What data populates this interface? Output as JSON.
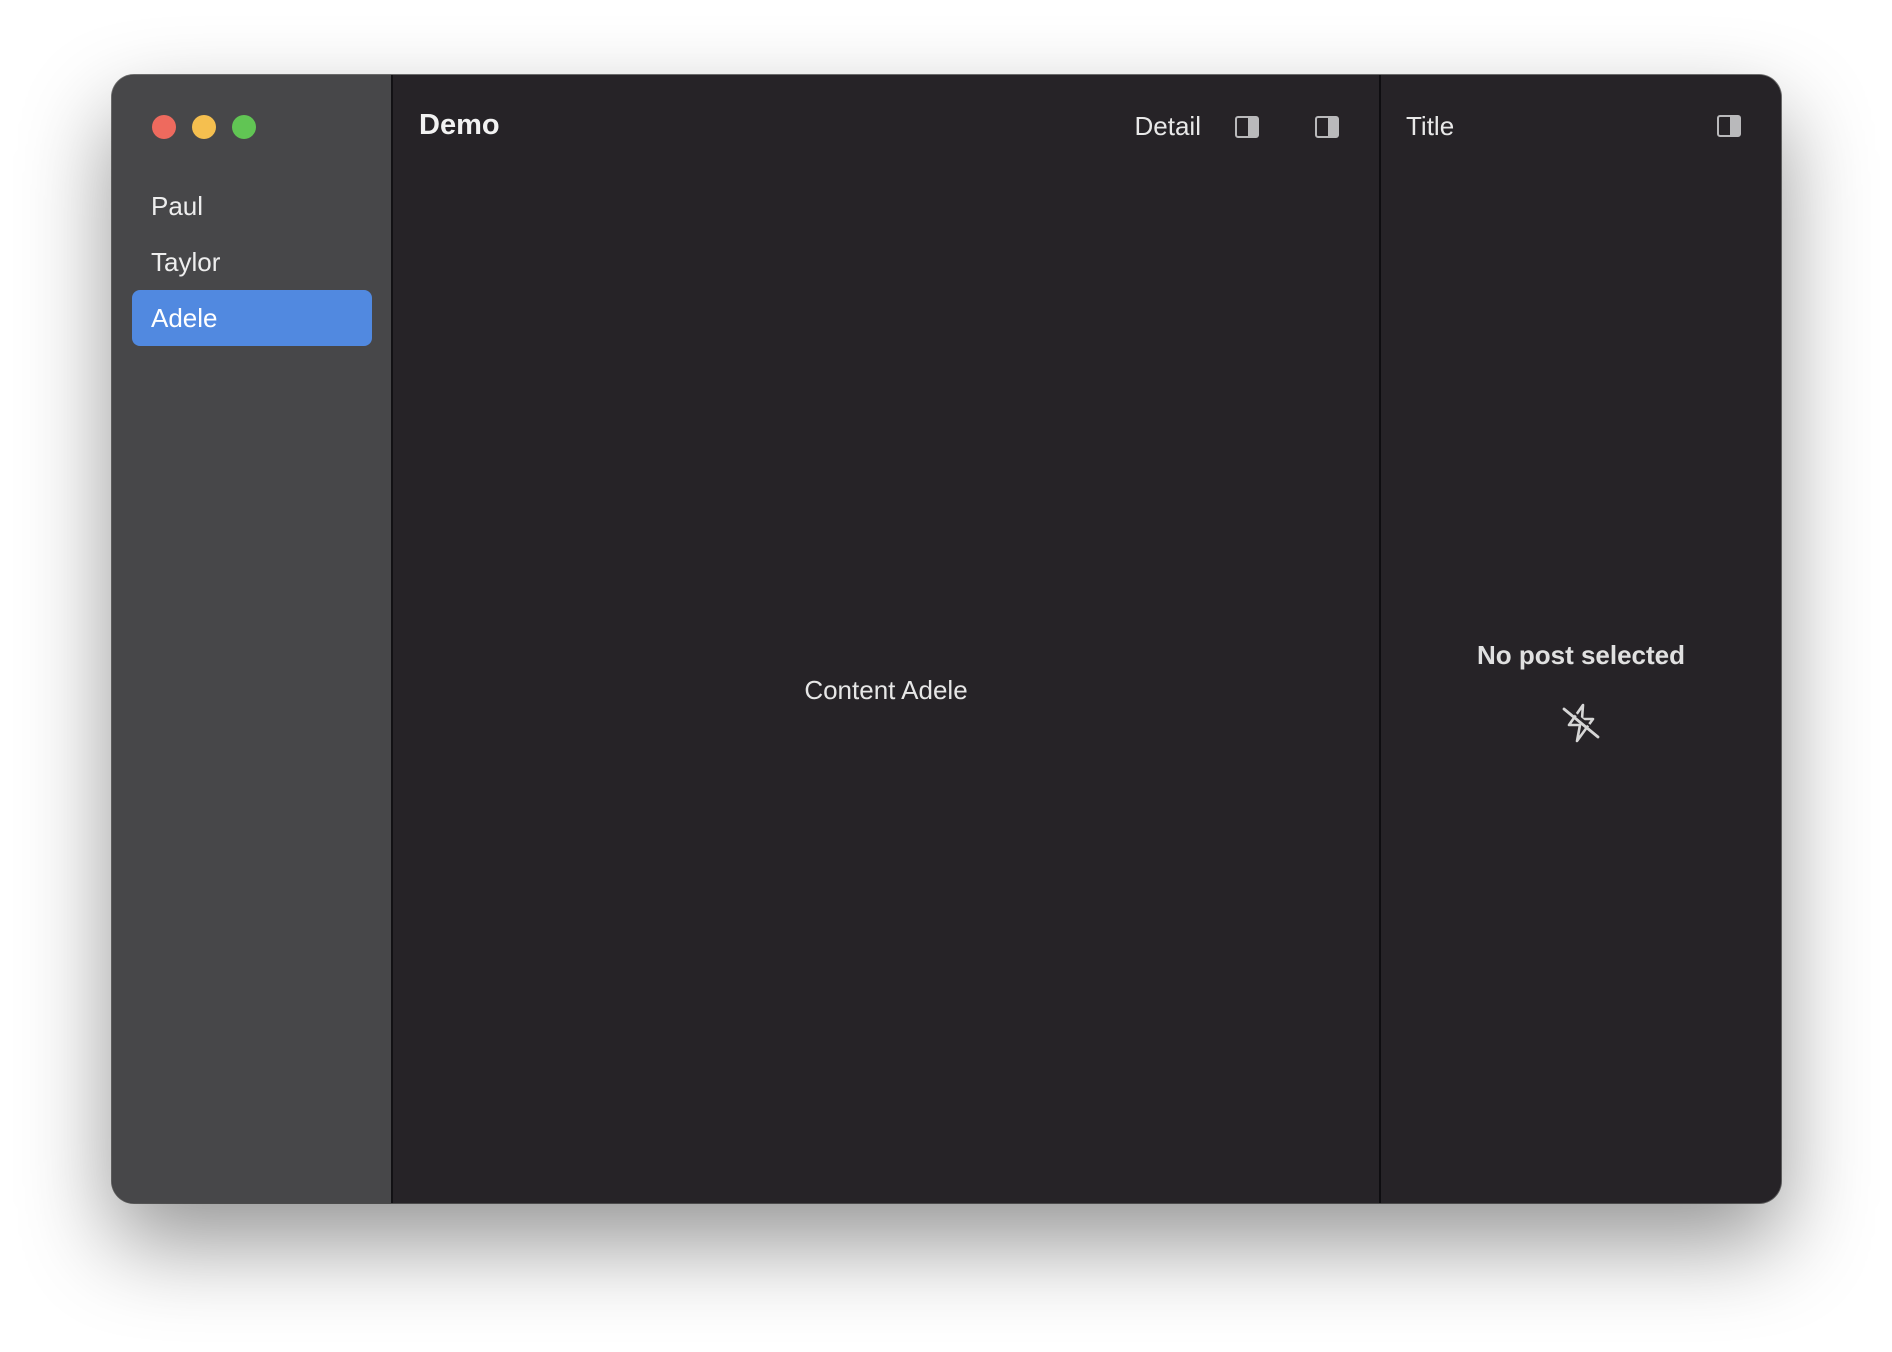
{
  "sidebar": {
    "traffic_lights": {
      "close": "#ee6a5e",
      "minimize": "#f5bf4f",
      "zoom": "#61c554"
    },
    "items": [
      {
        "label": "Paul",
        "selected": false
      },
      {
        "label": "Taylor",
        "selected": false
      },
      {
        "label": "Adele",
        "selected": true
      }
    ],
    "selection_color": "#5189e0"
  },
  "content": {
    "title": "Demo",
    "toolbar": {
      "detail_label": "Detail",
      "toggle_icons": [
        "sidebar-right-icon",
        "sidebar-right-icon"
      ]
    },
    "body_text": "Content Adele"
  },
  "detail": {
    "title": "Title",
    "toggle_icon": "sidebar-right-icon",
    "empty_state": {
      "text": "No post selected",
      "icon": "slash-bolt-icon"
    }
  }
}
